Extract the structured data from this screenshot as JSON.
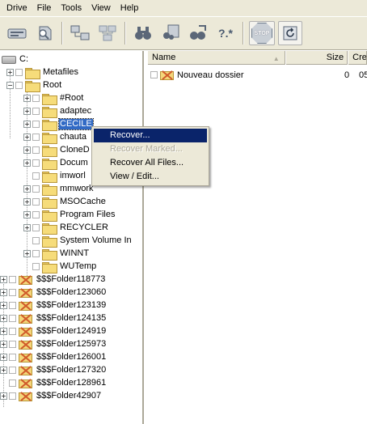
{
  "menu": [
    "Drive",
    "File",
    "Tools",
    "View",
    "Help"
  ],
  "toolbar": {
    "buttons": [
      "drive-icon",
      "scan-icon",
      "network-icon",
      "network-disk-icon",
      "binoculars-icon",
      "find-icon",
      "find-next-icon",
      "wildcard-icon",
      "stop-icon",
      "recover-icon"
    ],
    "wildcard_text": "?.*",
    "stop_text": "STOP"
  },
  "tree": {
    "drive": "C:",
    "metafiles": "Metafiles",
    "root": "Root",
    "root_children": [
      "#Root",
      "adaptec",
      "CECILE",
      "chauta",
      "CloneD",
      "Docum",
      "imworl",
      "mmwork",
      "MSOCache",
      "Program Files",
      "RECYCLER",
      "System Volume In",
      "WINNT",
      "WUTemp"
    ],
    "deleted_folders": [
      "$$$Folder118773",
      "$$$Folder123060",
      "$$$Folder123139",
      "$$$Folder124135",
      "$$$Folder124919",
      "$$$Folder125973",
      "$$$Folder126001",
      "$$$Folder127320",
      "$$$Folder128961",
      "$$$Folder42907"
    ]
  },
  "list": {
    "columns": {
      "name": "Name",
      "size": "Size",
      "created": "Cre"
    },
    "rows": [
      {
        "name": "Nouveau dossier",
        "size": "0",
        "created": "05"
      }
    ]
  },
  "context_menu": {
    "items": [
      {
        "label": "Recover...",
        "state": "highlighted"
      },
      {
        "label": "Recover Marked...",
        "state": "disabled"
      },
      {
        "label": "Recover All Files...",
        "state": "enabled"
      },
      {
        "label": "View / Edit...",
        "state": "enabled"
      }
    ]
  },
  "colors": {
    "selection": "#316ac5",
    "menu_highlight": "#0a246a",
    "chrome": "#ece9d8"
  }
}
